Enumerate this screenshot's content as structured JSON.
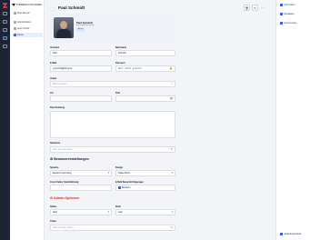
{
  "sidebar": {
    "org_name": "FORMEDIA TOOLSHARE",
    "items": [
      {
        "label": "Mein Bereich"
      },
      {
        "label": "Administration"
      },
      {
        "label": "Apps Verlink"
      },
      {
        "label": "Nutzer"
      }
    ]
  },
  "header": {
    "title": "Paul Schmidt",
    "more": "···"
  },
  "profile": {
    "name": "Paul Schmidt",
    "email": "p.schmidt@firma.de",
    "badge": "Admin"
  },
  "form": {
    "vorname": {
      "label": "Vorname",
      "value": "Paul"
    },
    "nachname": {
      "label": "Nachname",
      "value": "Schmidt"
    },
    "email": {
      "label": "E-Mail",
      "value": "p.schmidt@firma.de"
    },
    "passwort": {
      "label": "Passwort",
      "value": "Wert nicht gesetzt"
    },
    "avatar": {
      "label": "Avatar",
      "placeholder": "Bild hochladen"
    },
    "ort": {
      "label": "Ort",
      "value": ""
    },
    "titel": {
      "label": "Titel",
      "value": ""
    },
    "beschreibung": {
      "label": "Beschreibung"
    },
    "standorte": {
      "label": "Standorte",
      "placeholder": "Mehr als verknüpfen"
    }
  },
  "benutzer": {
    "title": "Benutzereinstellungen",
    "sprache": {
      "label": "Sprache",
      "value": "Deutsch (Germany)"
    },
    "design": {
      "label": "Design",
      "value": "Helles Motiv"
    },
    "zoom": {
      "label": "Zoom Faktor Seitenführung",
      "value": ""
    },
    "email_benach": {
      "label": "E-Mail Benachrichtigungen",
      "value": "Benutzer"
    }
  },
  "admin": {
    "title": "Admin-Optionen",
    "status": {
      "label": "Status",
      "value": "Aktiv"
    },
    "rolle": {
      "label": "Rolle",
      "value": "User"
    },
    "token": {
      "label": "Token",
      "placeholder": "Nicht erzeugt / Token"
    }
  },
  "right_panel": {
    "items": [
      {
        "label": "Information"
      },
      {
        "label": "Metadaten"
      },
      {
        "label": "Kommentare"
      }
    ],
    "footer": "Aktivitätsprotokoll"
  },
  "colors": {
    "accent": "#3b5bdb",
    "rail": "#1d2433",
    "danger": "#dc2626"
  }
}
